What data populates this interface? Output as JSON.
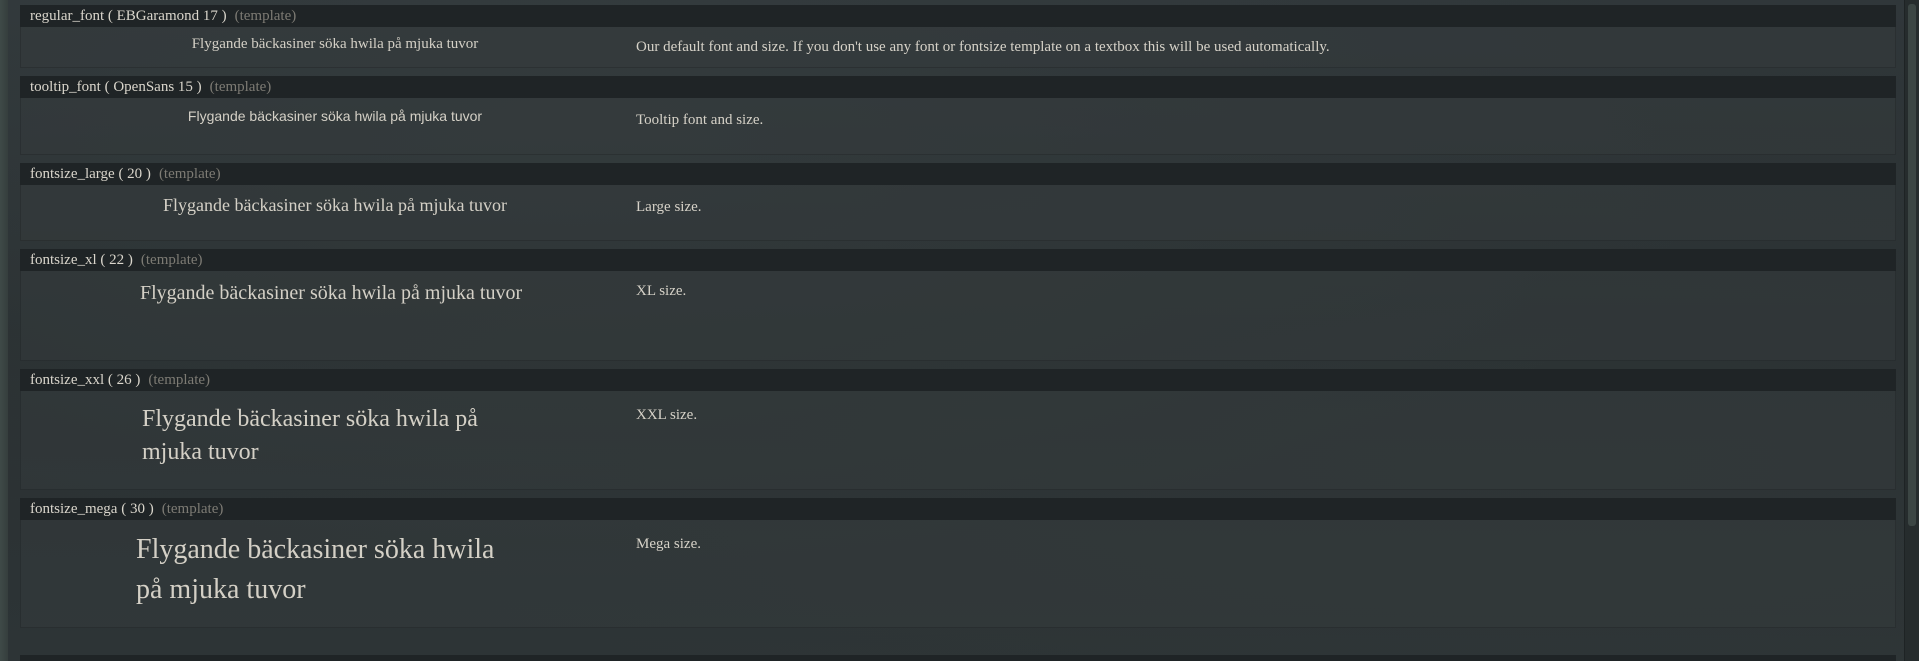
{
  "entries": [
    {
      "name": "regular_font ( EBGaramond 17 )",
      "tag": "(template)",
      "sample": "Flygande bäckasiner söka hwila på mjuka tuvor",
      "description": "Our default font and size. If you don't use any font or fontsize template on a textbox this will be used automatically."
    },
    {
      "name": "tooltip_font ( OpenSans 15 )",
      "tag": "(template)",
      "sample": "Flygande bäckasiner söka hwila på mjuka tuvor",
      "description": "Tooltip font and size."
    },
    {
      "name": "fontsize_large ( 20 )",
      "tag": "(template)",
      "sample": "Flygande bäckasiner söka hwila på mjuka tuvor",
      "description": "Large size."
    },
    {
      "name": "fontsize_xl ( 22 )",
      "tag": "(template)",
      "sample": "Flygande bäckasiner söka hwila på mjuka tuvor",
      "description": "XL size."
    },
    {
      "name": "fontsize_xxl ( 26 )",
      "tag": "(template)",
      "sample": "Flygande bäckasiner söka hwila på mjuka tuvor",
      "description": "XXL size."
    },
    {
      "name": "fontsize_mega ( 30 )",
      "tag": "(template)",
      "sample": "Flygande bäckasiner söka hwila på mjuka tuvor",
      "description": "Mega size."
    }
  ]
}
